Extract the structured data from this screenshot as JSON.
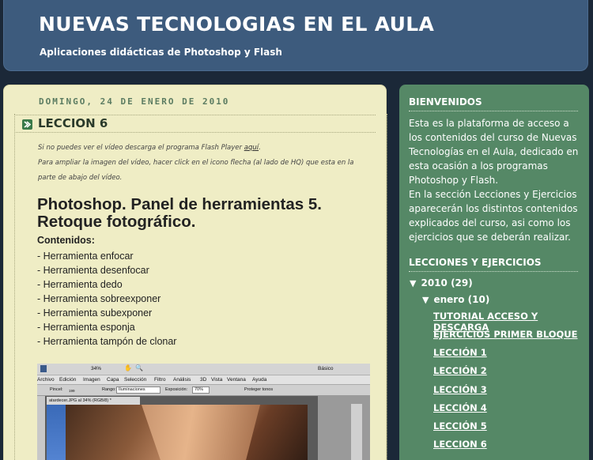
{
  "header": {
    "title": "NUEVAS TECNOLOGIAS EN EL AULA",
    "description": "Aplicaciones didácticas de Photoshop y Flash"
  },
  "post": {
    "date": "DOMINGO, 24 DE ENERO DE 2010",
    "title": "LECCION 6",
    "note1_before": "Si no puedes ver el vídeo descarga el programa Flash Player ",
    "note1_link": "aquí",
    "note1_after": ".",
    "note2a": "Para ampliar la imagen del vídeo, hacer click en el icono flecha (al lado de HQ) que esta en la",
    "note2b": "parte de abajo del vídeo.",
    "heading": "Photoshop. Panel de herramientas 5. Retoque fotográfico.",
    "contents_label": "Contenidos:",
    "tools": [
      "- Herramienta enfocar",
      "- Herramienta desenfocar",
      "- Herramienta dedo",
      "- Herramienta sobreexponer",
      "- Herramienta subexponer",
      "- Herramienta esponja",
      "- Herramienta tampón de clonar"
    ]
  },
  "screenshot": {
    "zoom": "34%",
    "workspace": "Básico",
    "menu": [
      "Archivo",
      "Edición",
      "Imagen",
      "Capa",
      "Selección",
      "Filtro",
      "Análisis",
      "3D",
      "Vista",
      "Ventana",
      "Ayuda"
    ],
    "brush_label": "Pincel:",
    "brush_size": "199",
    "range_label": "Rango:",
    "range_value": "Iluminaciones",
    "exposure_label": "Exposición:",
    "exposure_value": "70%",
    "protect_label": "Proteger tonos",
    "doc_tab": "atardecer.JPG al 34% (RGB/8) *"
  },
  "sidebar": {
    "welcome_title": "BIENVENIDOS",
    "welcome_text": "Esta es la plataforma de acceso a los contenidos del curso de Nuevas Tecnologías en el Aula, dedicado en esta ocasión a los programas Photoshop y Flash.",
    "welcome_text2": "En la sección Lecciones y Ejercicios aparecerán los distintos contenidos explicados del curso, asi como los ejercicios que se deberán realizar.",
    "archive_title": "LECCIONES Y EJERCICIOS",
    "year": "2010",
    "year_count": "(29)",
    "month": "enero",
    "month_count": "(10)",
    "links": [
      "TUTORIAL ACCESO Y DESCARGA",
      "EJERCICIOS PRIMER BLOQUE",
      "LECCIÓN 1",
      "LECCIÓN 2",
      "LECCIÓN 3",
      "LECCIÓN 4",
      "LECCIÓN 5",
      "LECCION 6"
    ]
  }
}
